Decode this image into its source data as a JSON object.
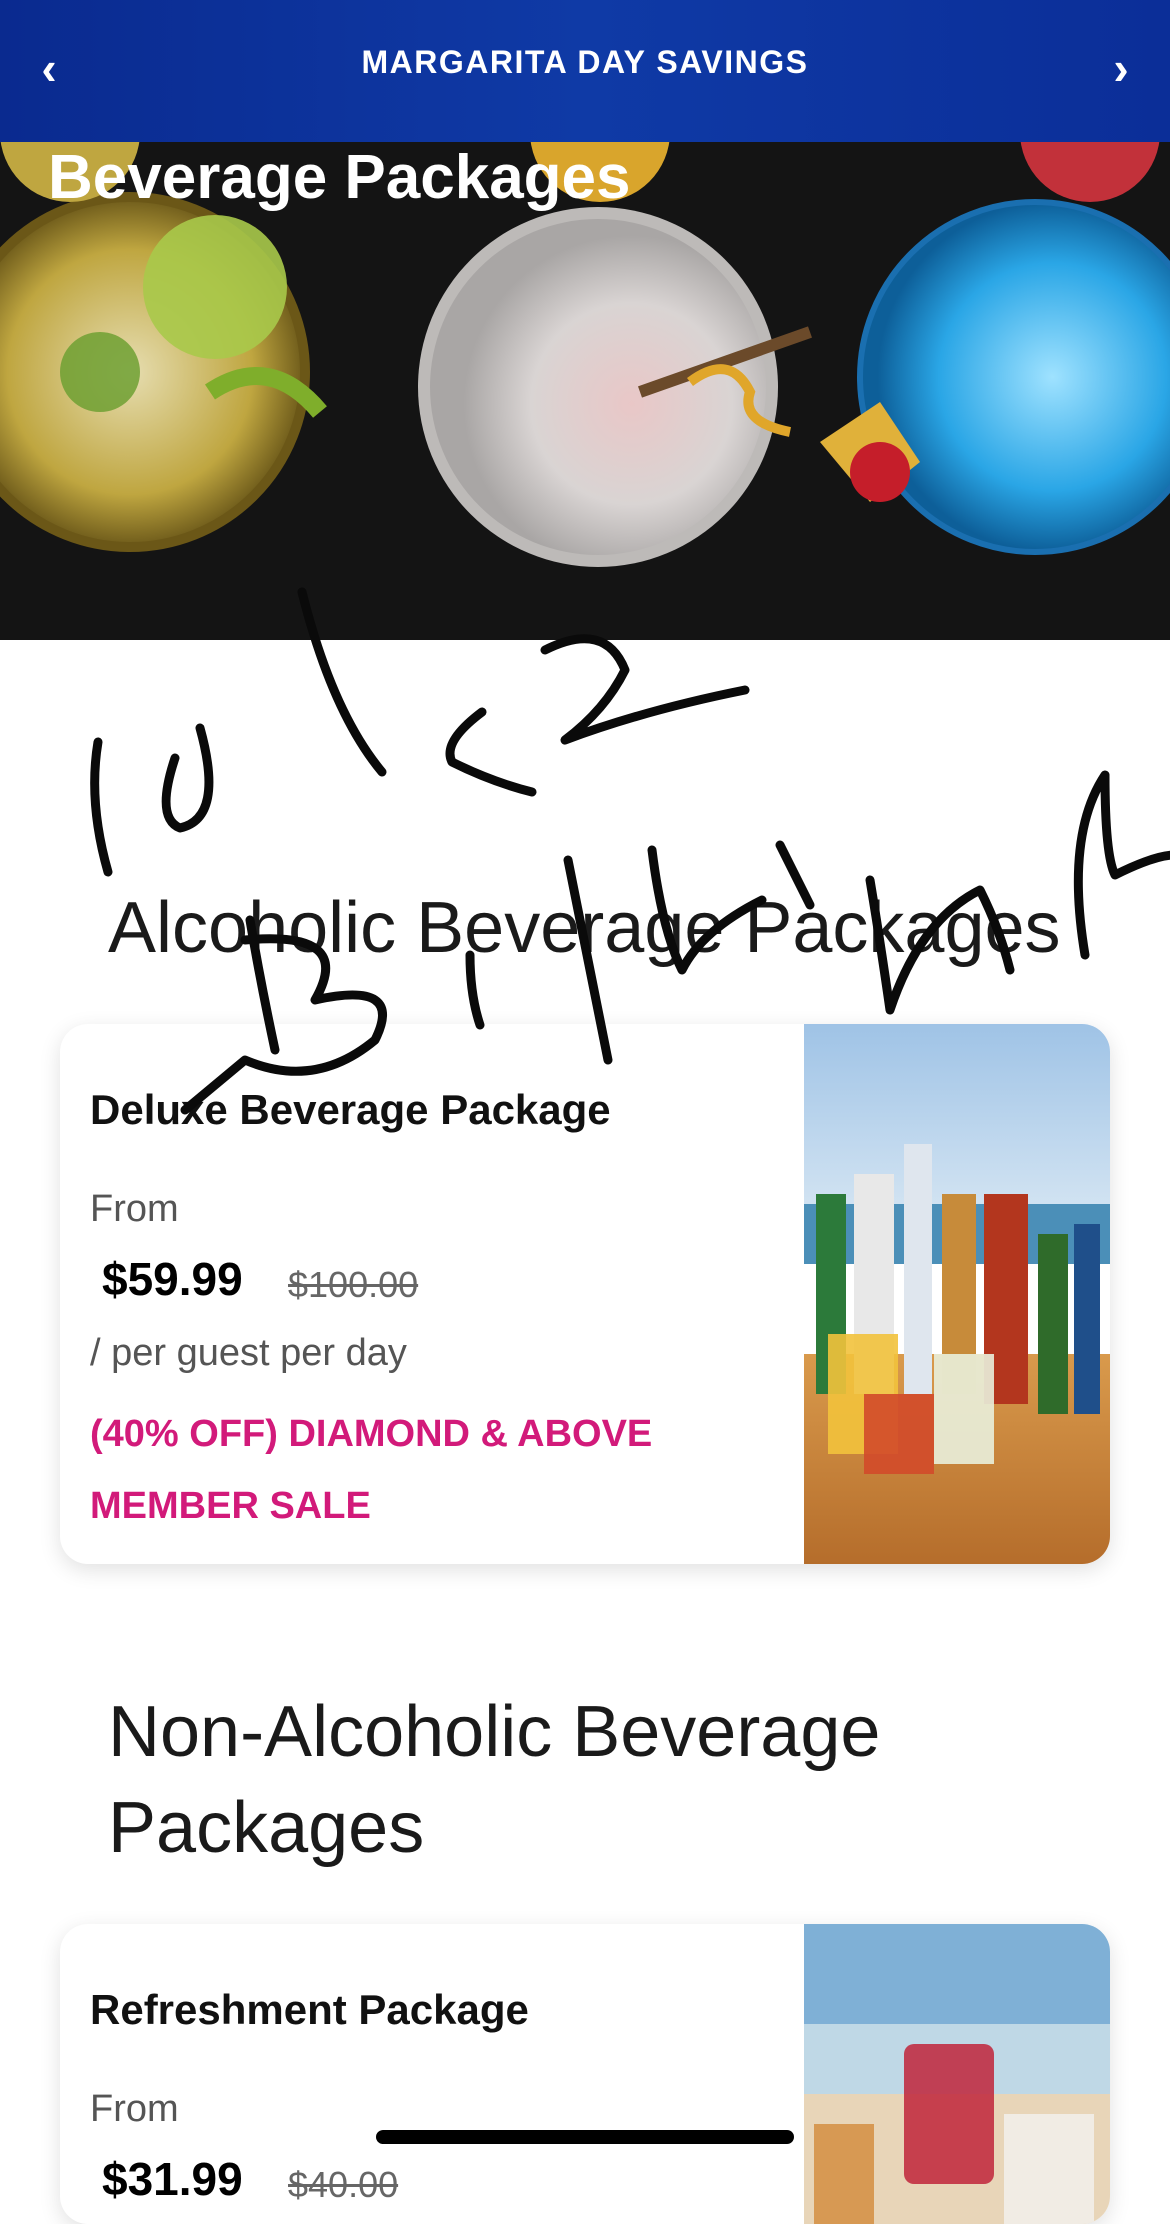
{
  "promo_bar": {
    "title": "MARGARITA DAY SAVINGS"
  },
  "hero": {
    "title": "Beverage Packages"
  },
  "sections": [
    {
      "heading": "Alcoholic Beverage Packages",
      "card": {
        "name": "Deluxe Beverage Package",
        "from_label": "From",
        "price": "$59.99",
        "old_price": "$100.00",
        "per_label": "/ per guest per day",
        "sale_text": "(40% OFF) DIAMOND & ABOVE MEMBER SALE"
      }
    },
    {
      "heading": "Non-Alcoholic Beverage Packages",
      "card": {
        "name": "Refreshment Package",
        "from_label": "From",
        "price": "$31.99",
        "old_price": "$40.00"
      }
    }
  ],
  "colors": {
    "promo_bar": "#0f3aa6",
    "sale_text": "#d21a7a",
    "hero_background": "#141414"
  },
  "icons": {
    "prev": "chevron-left-icon",
    "next": "chevron-right-icon"
  }
}
